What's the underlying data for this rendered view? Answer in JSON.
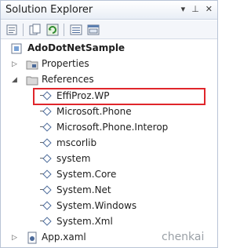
{
  "window": {
    "title": "Solution Explorer",
    "pin_glyph": "▾ ⊥ ✕"
  },
  "toolbar": {
    "icons": [
      "properties-icon",
      "show-all-files-icon",
      "refresh-icon",
      "view-code-icon",
      "view-designer-icon"
    ]
  },
  "tree": {
    "project": "AdoDotNetSample",
    "properties": "Properties",
    "references": "References",
    "items": [
      "EffiProz.WP",
      "Microsoft.Phone",
      "Microsoft.Phone.Interop",
      "mscorlib",
      "system",
      "System.Core",
      "System.Net",
      "System.Windows",
      "System.Xml"
    ],
    "app": "App.xaml"
  },
  "highlighted_item": "EffiProz.WP",
  "watermark": "chenkai",
  "colors": {
    "highlight": "#e0262b",
    "accent": "#4b6a9a"
  }
}
